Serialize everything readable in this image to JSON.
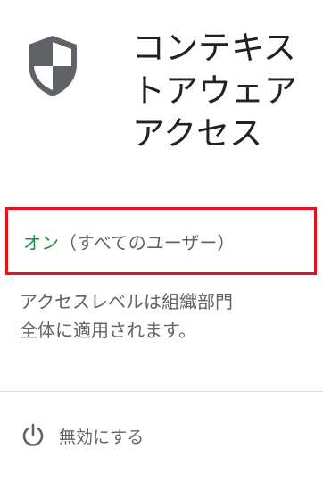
{
  "header": {
    "title_lines": [
      "コンテキス",
      "トアウェア",
      "アクセス"
    ],
    "icon": "shield-icon"
  },
  "status": {
    "state_label": "オン",
    "scope_label": "（すべてのユーザー）",
    "state_color": "#1e8e3e",
    "highlight_color": "#e3131b"
  },
  "description": {
    "lines": [
      "アクセスレベルは組織部門",
      "全体に適用されます。"
    ]
  },
  "actions": {
    "disable_label": "無効にする",
    "icon": "power-icon"
  }
}
